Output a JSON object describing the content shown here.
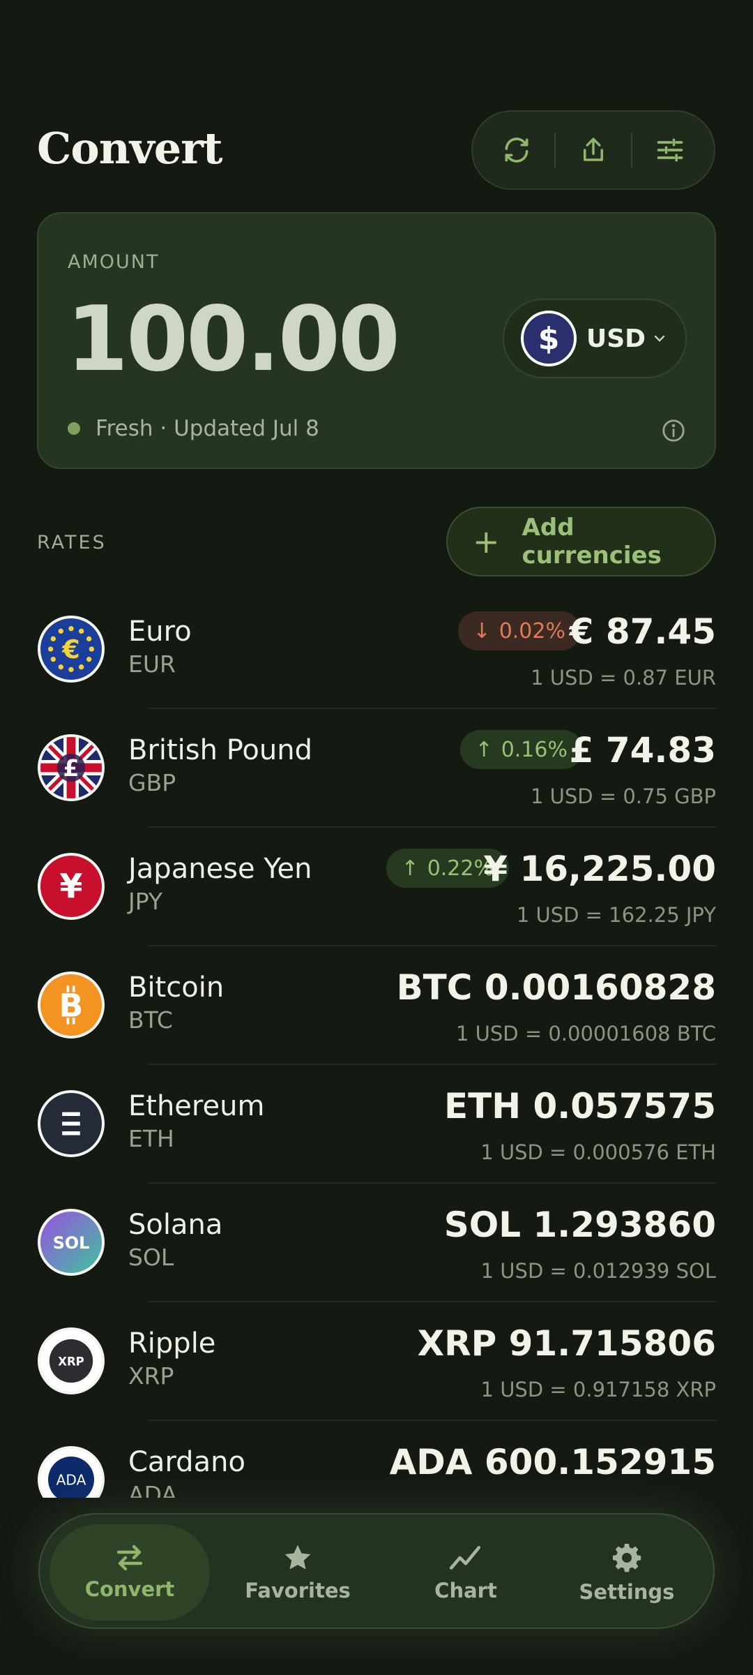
{
  "header": {
    "title": "Convert"
  },
  "toolbar": {
    "icons": [
      "refresh-icon",
      "share-icon",
      "filter-sliders-icon"
    ]
  },
  "amount_card": {
    "label": "AMOUNT",
    "value": "100.00",
    "currency": {
      "code": "USD",
      "symbol": "$"
    },
    "status": "Fresh · Updated Jul 8"
  },
  "rates": {
    "label": "RATES",
    "add_button": "Add currencies",
    "items": [
      {
        "name": "Euro",
        "code": "EUR",
        "amount": "€ 87.45",
        "rate": "1 USD = 0.87 EUR",
        "change": "0.02%",
        "direction": "down"
      },
      {
        "name": "British Pound",
        "code": "GBP",
        "amount": "£ 74.83",
        "rate": "1 USD = 0.75 GBP",
        "change": "0.16%",
        "direction": "up"
      },
      {
        "name": "Japanese Yen",
        "code": "JPY",
        "amount": "¥ 16,225.00",
        "rate": "1 USD = 162.25 JPY",
        "change": "0.22%",
        "direction": "up"
      },
      {
        "name": "Bitcoin",
        "code": "BTC",
        "amount": "BTC 0.00160828",
        "rate": "1 USD = 0.00001608 BTC"
      },
      {
        "name": "Ethereum",
        "code": "ETH",
        "amount": "ETH 0.057575",
        "rate": "1 USD = 0.000576 ETH"
      },
      {
        "name": "Solana",
        "code": "SOL",
        "amount": "SOL 1.293860",
        "rate": "1 USD = 0.012939 SOL"
      },
      {
        "name": "Ripple",
        "code": "XRP",
        "amount": "XRP 91.715806",
        "rate": "1 USD = 0.917158 XRP"
      },
      {
        "name": "Cardano",
        "code": "ADA",
        "amount": "ADA 600.152915",
        "rate": ""
      }
    ]
  },
  "nav": {
    "items": [
      {
        "label": "Convert",
        "icon": "swap-arrows-icon",
        "active": true
      },
      {
        "label": "Favorites",
        "icon": "star-icon",
        "active": false
      },
      {
        "label": "Chart",
        "icon": "chart-line-icon",
        "active": false
      },
      {
        "label": "Settings",
        "icon": "gear-icon",
        "active": false
      }
    ]
  },
  "colors": {
    "background": "#141912",
    "accent": "#9bc07a",
    "up": "#97c174",
    "down": "#e07a57"
  }
}
